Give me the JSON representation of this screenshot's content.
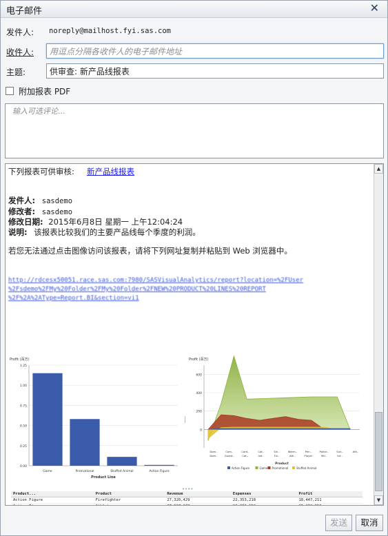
{
  "dialog": {
    "title": "电子邮件",
    "close_glyph": "✕"
  },
  "from": {
    "label": "发件人:",
    "value": "noreply@mailhost.fyi.sas.com"
  },
  "to": {
    "label": "收件人:",
    "placeholder": "用逗点分隔各收件人的电子邮件地址"
  },
  "subject": {
    "label": "主题:",
    "value": "供审查: 新产品线报表"
  },
  "attach": {
    "label": "附加报表 PDF",
    "checked": false
  },
  "comment": {
    "placeholder": "输入可选评论..."
  },
  "preview": {
    "intro": "下列报表可供审核:",
    "report_link": "新产品线报表",
    "meta": [
      {
        "label": "发件人:",
        "value": "sasdemo"
      },
      {
        "label": "修改者:",
        "value": "sasdemo"
      },
      {
        "label": "修改日期:",
        "value": "2015年6月8日 星期一 上午12:04:24"
      },
      {
        "label": "说明:",
        "value": "该报表比较我们的主要产品线每个季度的利润。"
      }
    ],
    "instructions": "若您无法通过点击图像访问该报表，请将下列网址复制并粘贴到 Web 浏览器中。",
    "url_lines": [
      "http://rdcesx50051.race.sas.com:7980/SASVisualAnalytics/report?location=%2FUser",
      "%2Fsdemo%2FMy%20Folder%2FMy%20Folder%2FNEW%20PRODUCT%20LINES%20REPORT",
      "%2F%2A%2AType=Report.BI&section=vi1"
    ]
  },
  "chart_data": [
    {
      "type": "bar",
      "ylabel": "Profit (百万)",
      "xlabel": "Product Line",
      "categories": [
        "Game",
        "Promotional",
        "Stuffed Animal",
        "Action Figure"
      ],
      "values": [
        1.15,
        0.58,
        0.11,
        0.01
      ],
      "ylim": [
        0,
        1.25
      ],
      "yticks": [
        "0.00",
        "0.25",
        "0.50",
        "0.75",
        "1.00",
        "1.25"
      ],
      "color": "#3a5ba9"
    },
    {
      "type": "area",
      "ylabel": "Profit (百万)",
      "xlabel": "Product",
      "yticks": [
        "0",
        "200",
        "400",
        "600"
      ],
      "ylim": [
        -200,
        700
      ],
      "categories": [
        "Dom..",
        "Com..",
        "Card..",
        "Cat..",
        "Sin..",
        "Warm..",
        "Pen..",
        "Police..",
        "Sun..",
        "Ath..",
        "Dom..",
        "Guard..",
        "Cat..",
        "Ind..",
        "Fin..",
        "Ath..",
        "Player",
        "Mrl..",
        "Int.."
      ],
      "series": [
        {
          "name": "Action Figure",
          "color": "#3a5ba9",
          "values": [
            0,
            10,
            10,
            10,
            10,
            10,
            10,
            10,
            10,
            10,
            10,
            10
          ]
        },
        {
          "name": "Game",
          "color": "#8db43a",
          "values": [
            -120,
            280,
            800,
            330,
            335,
            340,
            345,
            350,
            355,
            355,
            355,
            0
          ]
        },
        {
          "name": "Promotional",
          "color": "#a83a22",
          "values": [
            0,
            160,
            150,
            120,
            100,
            120,
            140,
            110,
            100,
            0,
            0,
            0
          ]
        },
        {
          "name": "Stuffed Animal",
          "color": "#e3c23a",
          "values": [
            -100,
            20,
            25,
            25,
            25,
            25,
            25,
            25,
            25,
            25,
            0,
            0
          ]
        }
      ],
      "legend_position": "bottom"
    }
  ],
  "table": {
    "headers": [
      "Product...",
      "Product",
      "Revenue",
      "Expenses",
      "Profit"
    ],
    "rows": [
      [
        "Action Figure",
        "Firefighter",
        "27,320,429",
        "22,353,218",
        "18,447,211"
      ],
      [
        "Action Figure",
        "Athlete",
        "37,507,138",
        "22,332,153",
        "15,230,956"
      ]
    ]
  },
  "buttons": {
    "send": "发送",
    "cancel": "取消"
  }
}
